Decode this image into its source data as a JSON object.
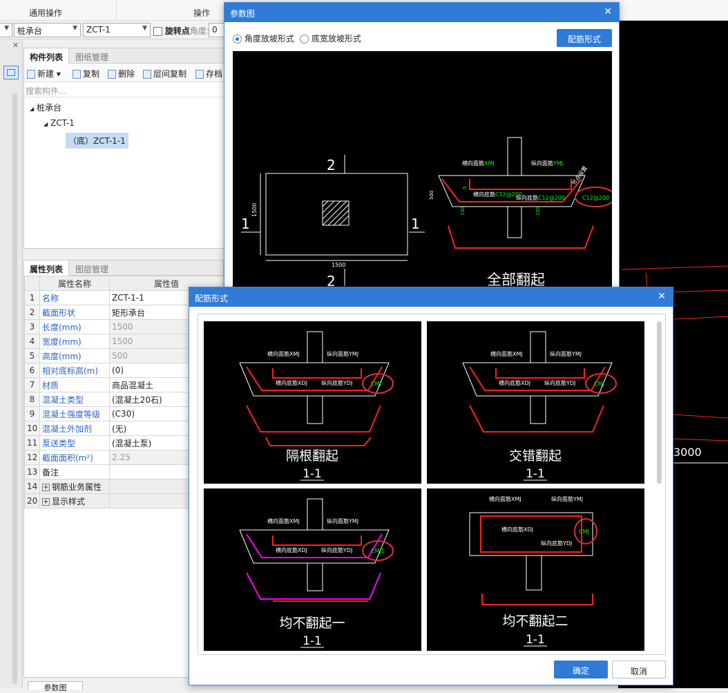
{
  "ribbon": {
    "group1": "通用操作",
    "group2": "操作"
  },
  "toolbar": {
    "type_combo": "桩承台",
    "element_combo": "ZCT-1",
    "rotate_label": "旋转点",
    "angle_label": "角度:",
    "angle_value": "0"
  },
  "component_panel": {
    "tabs": [
      "构件列表",
      "图纸管理"
    ],
    "buttons": [
      "新建",
      "复制",
      "删除",
      "层间复制",
      "存档"
    ],
    "search_placeholder": "搜索构件...",
    "tree": {
      "root": "桩承台",
      "child": "ZCT-1",
      "leaf": "（底）ZCT-1-1"
    }
  },
  "property_panel": {
    "tabs": [
      "属性列表",
      "图层管理"
    ],
    "headers": {
      "name": "属性名称",
      "value": "属性值"
    },
    "rows": [
      {
        "idx": "1",
        "name": "名称",
        "value": "ZCT-1-1"
      },
      {
        "idx": "2",
        "name": "截面形状",
        "value": "矩形承台"
      },
      {
        "idx": "3",
        "name": "长度(mm)",
        "value": "1500"
      },
      {
        "idx": "4",
        "name": "宽度(mm)",
        "value": "1500"
      },
      {
        "idx": "5",
        "name": "高度(mm)",
        "value": "500"
      },
      {
        "idx": "6",
        "name": "相对底标高(m)",
        "value": "(0)"
      },
      {
        "idx": "7",
        "name": "材质",
        "value": "商品混凝土"
      },
      {
        "idx": "8",
        "name": "混凝土类型",
        "value": "(混凝土20石)"
      },
      {
        "idx": "9",
        "name": "混凝土强度等级",
        "value": "(C30)"
      },
      {
        "idx": "10",
        "name": "混凝土外加剂",
        "value": "(无)"
      },
      {
        "idx": "11",
        "name": "泵送类型",
        "value": "(混凝土泵)"
      },
      {
        "idx": "12",
        "name": "截面面积(m²)",
        "value": "2.25"
      },
      {
        "idx": "13",
        "name": "备注",
        "value": ""
      },
      {
        "idx": "14",
        "name": "钢筋业务属性",
        "value": ""
      },
      {
        "idx": "20",
        "name": "显示样式",
        "value": ""
      }
    ],
    "bottom_tab": "参数图"
  },
  "cad_right": {
    "dimension": "3000"
  },
  "param_dialog": {
    "title": "参数图",
    "radio_angle": "角度放坡形式",
    "radio_width": "底宽放坡形式",
    "rebar_button": "配筋形式",
    "plan": {
      "dim_h": "1500",
      "dim_w": "1500",
      "label_top": "2",
      "label_bottom": "2",
      "label_left": "1",
      "label_right": "1"
    },
    "section": {
      "top_label": "横向面筋",
      "top_code": "XMJ",
      "long_top_label": "纵向面筋",
      "long_top_code": "YMJ",
      "bottom_label": "横向底筋",
      "bottom_value": "C12@200",
      "long_bottom_label": "纵向底筋",
      "long_bottom_value": "C12@200",
      "side_value": "C12@200",
      "side_label": "节点设置",
      "height_dim": "500",
      "left_dim": "100",
      "mid_dim": "100",
      "zero": "0",
      "caption": "全部翻起"
    }
  },
  "rebar_dialog": {
    "title": "配筋形式",
    "ok": "确定",
    "cancel": "取消",
    "options": [
      {
        "caption": "隔根翻起",
        "section": "1-1",
        "side_code": "CMJ",
        "top": "横向面筋XMJ",
        "long_top": "纵向面筋YMJ",
        "bottom": "横向底筋XDJ",
        "long_bottom": "纵向底筋YDJ"
      },
      {
        "caption": "交错翻起",
        "section": "1-1",
        "side_code": "CMJ",
        "top": "横向面筋XMJ",
        "long_top": "纵向面筋YMJ",
        "bottom": "横向底筋XDJ",
        "long_bottom": "纵向底筋YDJ"
      },
      {
        "caption": "均不翻起一",
        "section": "1-1",
        "side_code": "CMJ1",
        "top": "横向面筋XMJ",
        "long_top": "纵向面筋YMJ",
        "bottom": "横向底筋XDJ",
        "long_bottom": "纵向底筋YDJ"
      },
      {
        "caption": "均不翻起二",
        "section": "1-1",
        "side_code": "CMJ",
        "top": "横向面筋XMJ",
        "long_top": "纵向面筋YMJ",
        "bottom": "横向底筋XDJ",
        "long_bottom": "纵向底筋YDJ"
      }
    ]
  },
  "colors": {
    "accent": "#2f7bd6",
    "rebar": "#ff2020",
    "annotation": "#00ff00",
    "highlight": "#e03030"
  }
}
